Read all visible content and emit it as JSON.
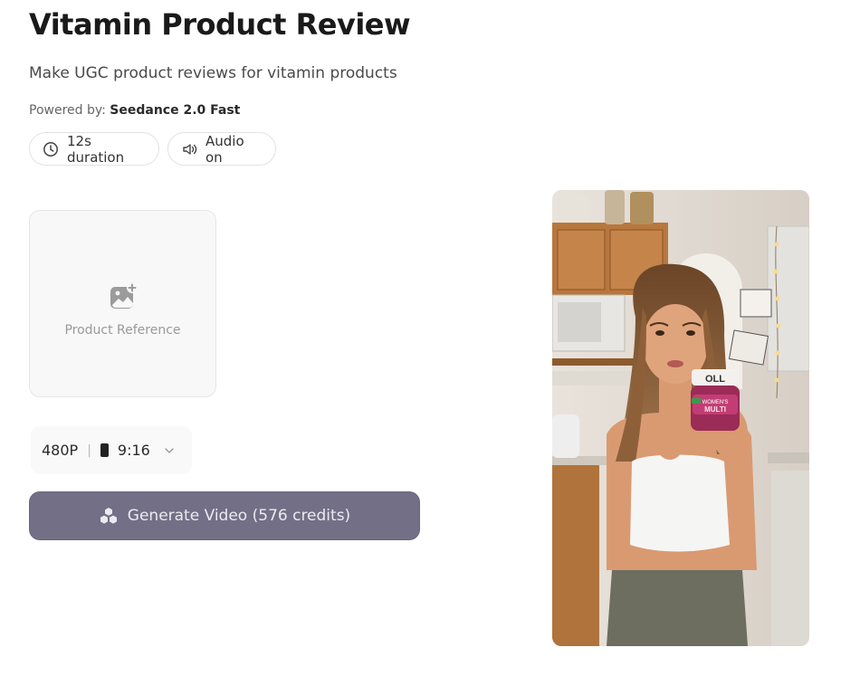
{
  "header": {
    "title": "Vitamin Product Review",
    "subtitle": "Make UGC product reviews for vitamin products",
    "powered_prefix": "Powered by:",
    "powered_model": "Seedance 2.0 Fast"
  },
  "chips": {
    "duration": {
      "label": "12s duration",
      "icon": "clock-icon"
    },
    "audio": {
      "label": "Audio on",
      "icon": "speaker-icon"
    }
  },
  "upload": {
    "label": "Product Reference",
    "icon": "add-image-icon"
  },
  "settings": {
    "resolution": "480P",
    "separator": "|",
    "aspect_ratio": "9:16",
    "icon": "chevron-down-icon"
  },
  "generate": {
    "label": "Generate Video (576 credits)",
    "icon": "cubes-icon"
  },
  "preview": {
    "jar_brand": "OLL",
    "jar_label_1": "WOMEN'S",
    "jar_label_2": "MULTI"
  },
  "colors": {
    "generate_bg": "#736f86",
    "chip_border": "#e2e2e2",
    "upload_bg": "#f8f8f8"
  }
}
